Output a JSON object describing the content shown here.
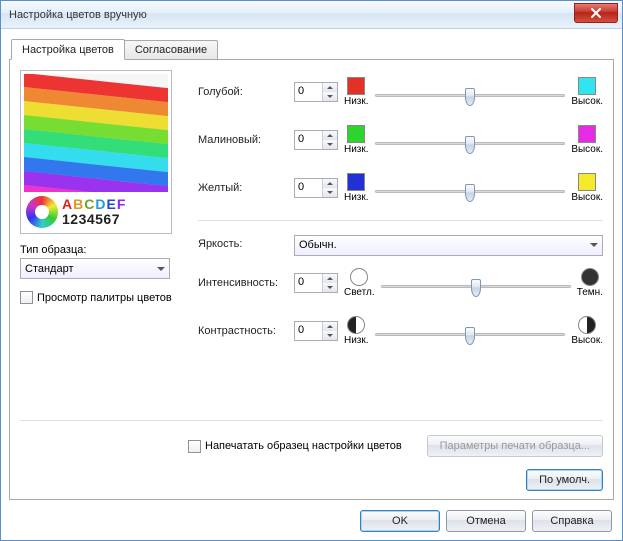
{
  "window": {
    "title": "Настройка цветов вручную"
  },
  "tabs": {
    "color": "Настройка цветов",
    "match": "Согласование"
  },
  "left": {
    "sample_letters": "ABCDEF",
    "sample_numbers": "1234567",
    "type_label": "Тип образца:",
    "type_value": "Стандарт",
    "palette_checkbox": "Просмотр палитры цветов"
  },
  "rows": {
    "cyan": {
      "label": "Голубой:",
      "value": "0"
    },
    "magenta": {
      "label": "Малиновый:",
      "value": "0"
    },
    "yellow": {
      "label": "Желтый:",
      "value": "0"
    },
    "brightness": {
      "label": "Яркость:",
      "value": "Обычн."
    },
    "intensity": {
      "label": "Интенсивность:",
      "value": "0"
    },
    "contrast": {
      "label": "Контрастность:",
      "value": "0"
    }
  },
  "scale": {
    "low": "Низк.",
    "high": "Высок.",
    "light": "Светл.",
    "dark": "Темн."
  },
  "colors": {
    "red": "#e33126",
    "cyan": "#2fe5ef",
    "green": "#2bd52b",
    "magenta": "#e52be5",
    "blue": "#2131d5",
    "yellow": "#f4e92b"
  },
  "bottom": {
    "print_sample": "Напечатать образец настройки цветов",
    "print_params": "Параметры печати образца...",
    "defaults": "По умолч."
  },
  "buttons": {
    "ok": "OK",
    "cancel": "Отмена",
    "help": "Справка"
  }
}
